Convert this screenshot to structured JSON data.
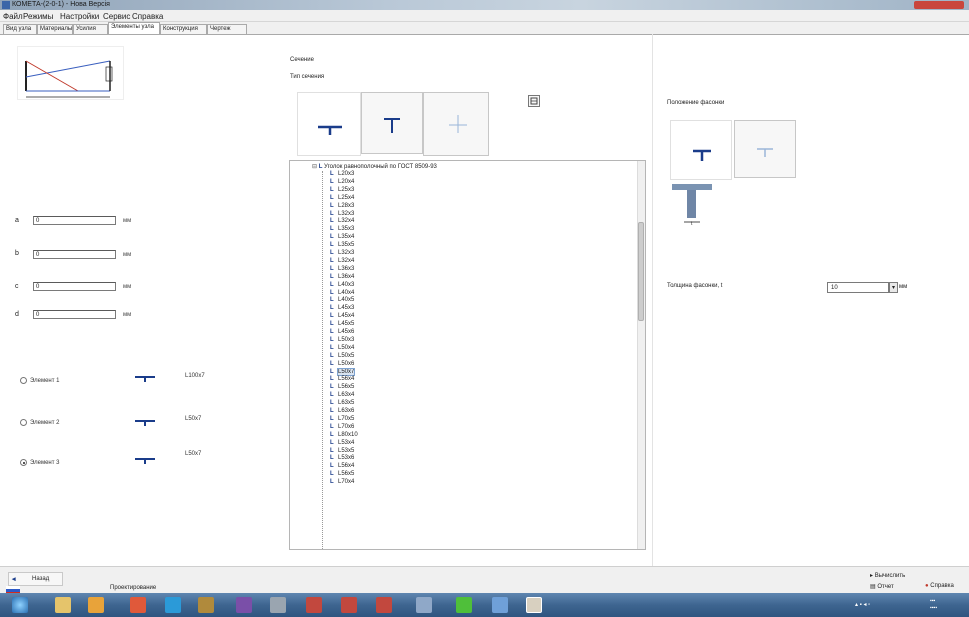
{
  "window": {
    "title": "КОМЕТА-(2-0-1) - Нова Версія"
  },
  "menu": [
    "Файл",
    "Режимы",
    "Настройки",
    "Сервис",
    "Справка"
  ],
  "tabs": [
    {
      "label": "Вид узла"
    },
    {
      "label": "Материалы"
    },
    {
      "label": "Усилия"
    },
    {
      "label": "Элементы узла",
      "active": true
    },
    {
      "label": "Конструкция"
    },
    {
      "label": "Чертеж"
    }
  ],
  "left": {
    "params": [
      {
        "label": "a",
        "value": "0",
        "unit": "мм"
      },
      {
        "label": "b",
        "value": "0",
        "unit": "мм"
      },
      {
        "label": "c",
        "value": "0",
        "unit": "мм"
      },
      {
        "label": "d",
        "value": "0",
        "unit": "мм"
      }
    ],
    "elements": [
      {
        "label": "Элемент 1",
        "profile": "L100x7",
        "checked": false
      },
      {
        "label": "Элемент 2",
        "profile": "L50x7",
        "checked": false
      },
      {
        "label": "Элемент 3",
        "profile": "L50x7",
        "checked": true
      }
    ]
  },
  "section": {
    "group_label": "Сечение",
    "type_label": "Тип сечения",
    "tree_root": "Уголок равнополочный по ГОСТ 8509-93",
    "tree_items": [
      "L20x3",
      "L20x4",
      "L25x3",
      "L25x4",
      "L28x3",
      "L32x3",
      "L32x4",
      "L35x3",
      "L35x4",
      "L35x5",
      "L32x3",
      "L32x4",
      "L36x3",
      "L36x4",
      "L40x3",
      "L40x4",
      "L40x5",
      "L45x3",
      "L45x4",
      "L45x5",
      "L45x6",
      "L50x3",
      "L50x4",
      "L50x5",
      "L50x6",
      "L50x7",
      "L56x4",
      "L56x5",
      "L63x4",
      "L63x5",
      "L63x6",
      "L70x5",
      "L70x6",
      "L80x10",
      "L53x4",
      "L53x5",
      "L53x6",
      "L56x4",
      "L56x5",
      "L70x4"
    ],
    "selected_item": "L50x7"
  },
  "right": {
    "placement_label": "Положение фасонки",
    "thickness_label": "Толщина фасонки, t",
    "thickness_value": "10",
    "thickness_unit": "мм"
  },
  "bottom": {
    "back_label": "Назад",
    "status_text": "Проектирование",
    "calc_label": "Вычислить",
    "report_label": "Отчет",
    "help_label": "Справка"
  },
  "colors": {
    "selection": "#d8e3f0",
    "taskbar": "#3e6590",
    "accent": "#1a3c8a"
  }
}
